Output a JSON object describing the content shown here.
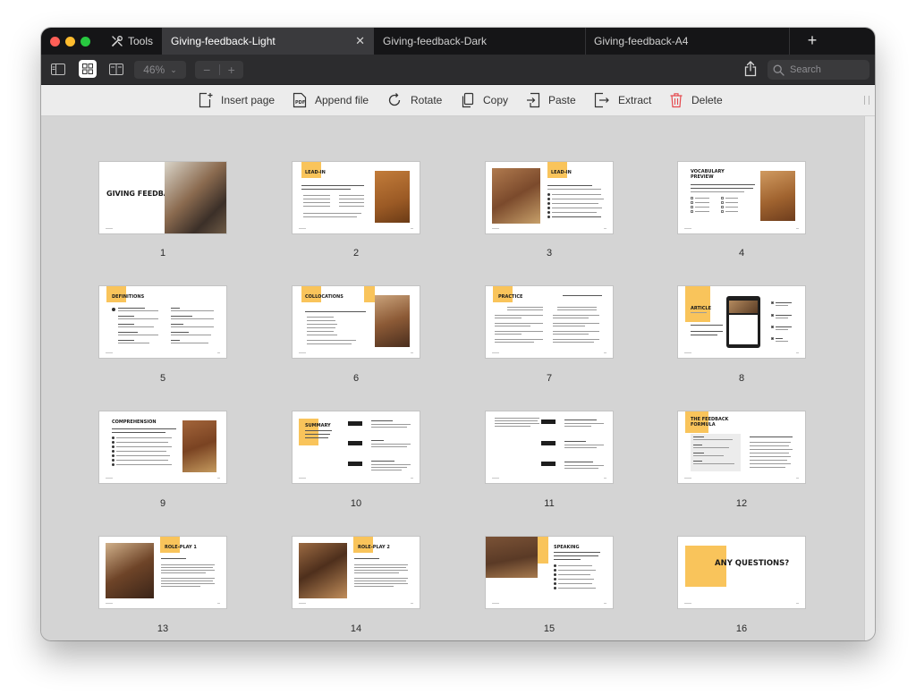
{
  "window": {
    "tools_label": "Tools",
    "tabs": [
      {
        "label": "Giving-feedback-Light",
        "active": true
      },
      {
        "label": "Giving-feedback-Dark",
        "active": false
      },
      {
        "label": "Giving-feedback-A4",
        "active": false
      }
    ],
    "new_tab_icon": "plus-icon",
    "close_tab_icon": "close-icon"
  },
  "toolbar": {
    "view_icons": [
      "sidebar-icon",
      "grid-view-icon",
      "page-view-icon"
    ],
    "zoom_value": "46%",
    "zoom_out": "−",
    "zoom_in": "+",
    "share_icon": "share-icon",
    "search_placeholder": "Search"
  },
  "actions": [
    {
      "label": "Insert page",
      "icon": "insert-page-icon"
    },
    {
      "label": "Append file",
      "icon": "append-pdf-icon"
    },
    {
      "label": "Rotate",
      "icon": "rotate-icon"
    },
    {
      "label": "Copy",
      "icon": "copy-icon"
    },
    {
      "label": "Paste",
      "icon": "paste-icon"
    },
    {
      "label": "Extract",
      "icon": "extract-icon"
    },
    {
      "label": "Delete",
      "icon": "trash-icon",
      "color": "#e5484d"
    }
  ],
  "pages": [
    {
      "number": "1",
      "title": "GIVING FEEDBACK"
    },
    {
      "number": "2",
      "title": "LEAD-IN"
    },
    {
      "number": "3",
      "title": "LEAD-IN"
    },
    {
      "number": "4",
      "title": "VOCABULARY PREVIEW"
    },
    {
      "number": "5",
      "title": "DEFINITIONS"
    },
    {
      "number": "6",
      "title": "COLLOCATIONS"
    },
    {
      "number": "7",
      "title": "PRACTICE"
    },
    {
      "number": "8",
      "title": "ARTICLE"
    },
    {
      "number": "9",
      "title": "COMPREHENSION"
    },
    {
      "number": "10",
      "title": "SUMMARY"
    },
    {
      "number": "11",
      "title": ""
    },
    {
      "number": "12",
      "title": "THE FEEDBACK FORMULA"
    },
    {
      "number": "13",
      "title": "ROLE-PLAY 1"
    },
    {
      "number": "14",
      "title": "ROLE-PLAY 2"
    },
    {
      "number": "15",
      "title": "SPEAKING"
    },
    {
      "number": "16",
      "title": "ANY QUESTIONS?"
    }
  ],
  "colors": {
    "accent_yellow": "#f9c45b",
    "tabbar_bg": "#151517",
    "toolbar_bg": "#2c2c2e",
    "delete_red": "#e5484d"
  }
}
